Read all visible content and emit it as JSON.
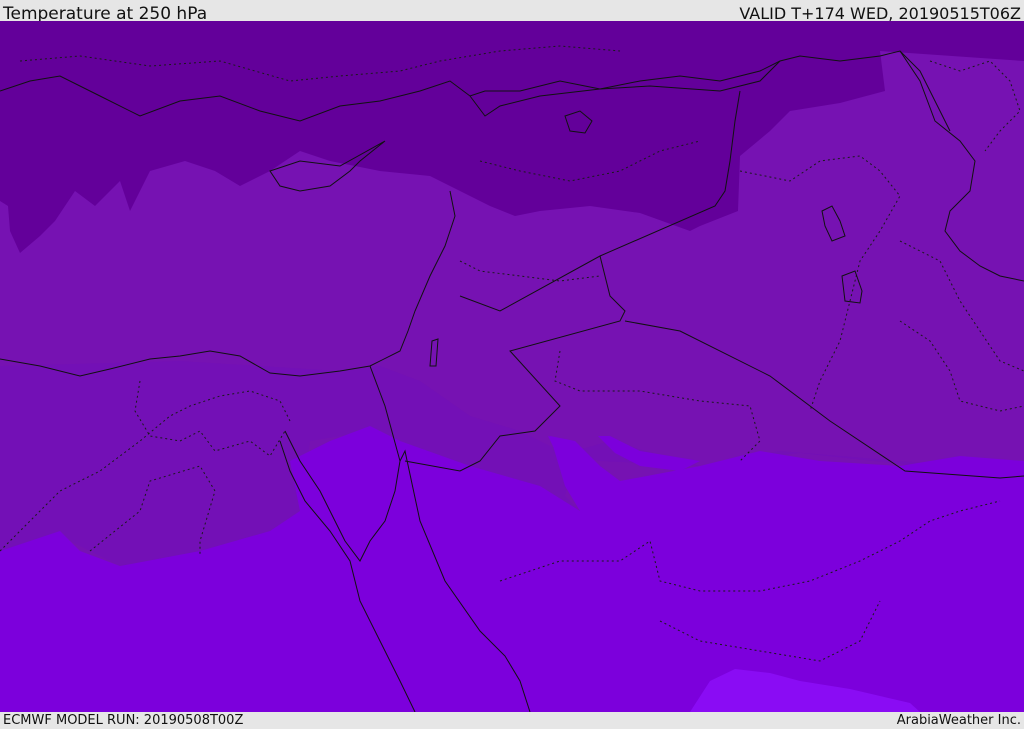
{
  "header": {
    "title": "Temperature at 250 hPa",
    "valid_time": "VALID T+174 WED, 20190515T06Z"
  },
  "footer": {
    "model_run": "ECMWF MODEL RUN: 20190508T00Z",
    "credit": "ArabiaWeather Inc."
  },
  "map": {
    "field": "temperature",
    "level": "250 hPa",
    "colors": {
      "coldest_band": "#63009a",
      "cold_band": "#7612b2",
      "mid_band": "#7a10c2",
      "warm_band": "#7c00dc",
      "warmest_band": "#8a0cf4"
    }
  }
}
